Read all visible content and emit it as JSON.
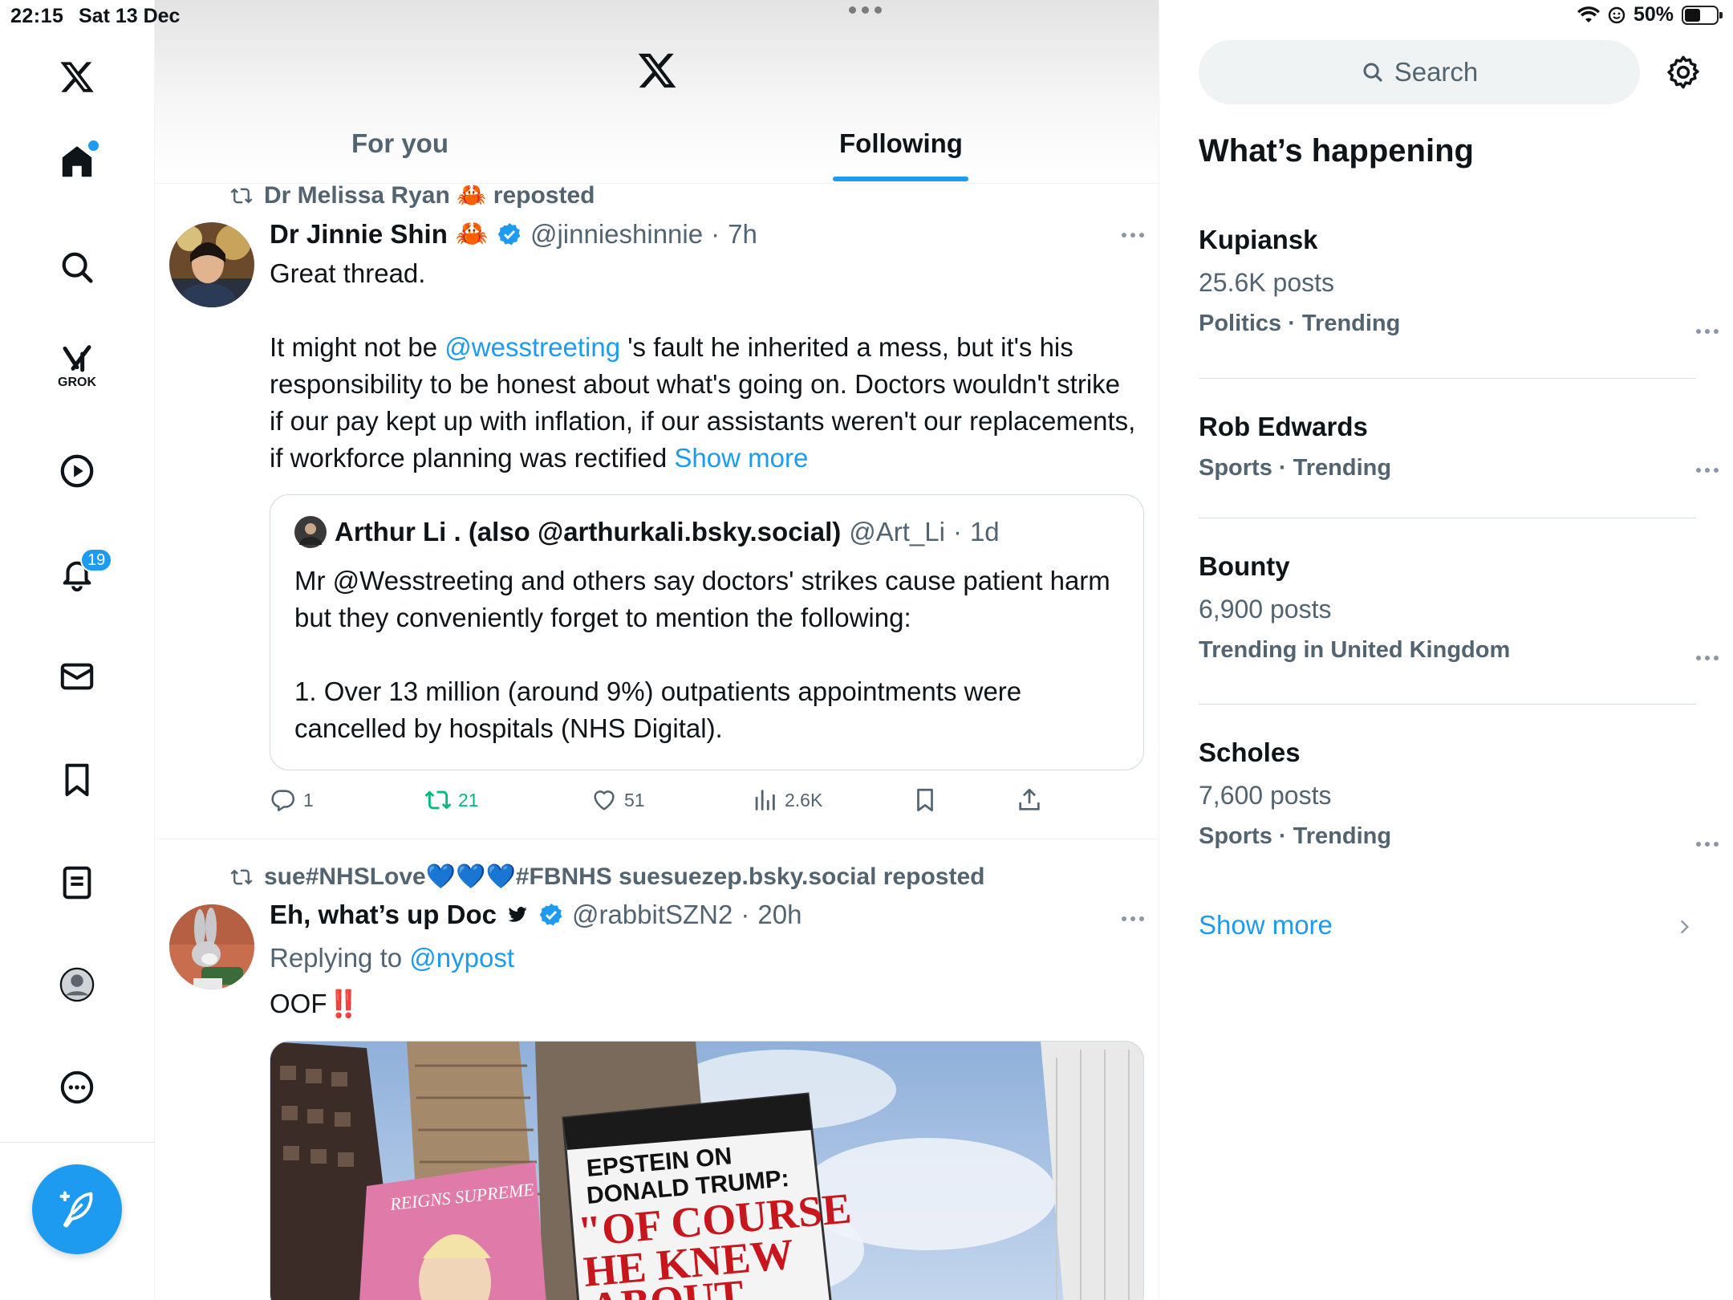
{
  "status": {
    "time": "22:15",
    "date": "Sat 13 Dec",
    "battery": "50%"
  },
  "nav": {
    "items": [
      "home-icon",
      "search-icon",
      "grok-icon",
      "video-icon",
      "notifications-icon",
      "messages-icon",
      "bookmarks-icon",
      "lists-icon",
      "profile-icon",
      "more-icon"
    ],
    "grok_label": "GROK",
    "notifications_badge": "19"
  },
  "header": {
    "tabs": [
      {
        "label": "For you",
        "active": false
      },
      {
        "label": "Following",
        "active": true
      }
    ]
  },
  "tweets": [
    {
      "repost_by": "Dr Melissa Ryan 🦀 reposted",
      "author_name": "Dr Jinnie Shin",
      "author_emoji": "🦀",
      "handle": "@jinnieshinnie",
      "sep": "·",
      "time": "7h",
      "text_line1": "Great thread.",
      "text_p2_a": "It might not be ",
      "mention": "@wesstreeting",
      "text_p2_b": " 's fault he inherited a mess, but it's his responsibility to be honest about what's going on. Doctors wouldn't strike if our pay kept up with inflation, if our assistants weren't our replacements, if workforce planning was rectified ",
      "show_more": "Show more",
      "quote": {
        "author_name": "Arthur Li . (also @arthurkali.bsky.social)",
        "handle": "@Art_Li",
        "sep": "·",
        "time": "1d",
        "p1": "Mr @Wesstreeting and others say doctors' strikes cause patient harm but they conveniently forget to mention the following:",
        "p2": "1. Over 13 million (around 9%) outpatients appointments were cancelled by hospitals (NHS Digital)."
      },
      "actions": {
        "replies": "1",
        "reposts": "21",
        "likes": "51",
        "views": "2.6K"
      }
    },
    {
      "repost_by": "sue#NHSLove💙💙💙#FBNHS suesuezep.bsky.social reposted",
      "author_name": "Eh, what’s up Doc",
      "handle": "@rabbitSZN2",
      "sep": "·",
      "time": "20h",
      "replying_prefix": "Replying to ",
      "replying_to": "@nypost",
      "text": "OOF",
      "text_emoji": "‼️",
      "media": {
        "billboard_line1": "EPSTEIN ON",
        "billboard_line2": "DONALD TRUMP:",
        "billboard_line3": "\"OF COURSE",
        "billboard_line4": "HE KNEW",
        "billboard_line5": "ABOUT",
        "left_sign": "REIGNS SUPREME"
      }
    }
  ],
  "sidebar": {
    "search_placeholder": "Search",
    "title": "What’s happening",
    "trends": [
      {
        "name": "Kupiansk",
        "count": "25.6K posts",
        "category": "Politics · Trending"
      },
      {
        "name": "Rob Edwards",
        "count": "",
        "category": "Sports · Trending"
      },
      {
        "name": "Bounty",
        "count": "6,900 posts",
        "category": "Trending in United Kingdom"
      },
      {
        "name": "Scholes",
        "count": "7,600 posts",
        "category": "Sports · Trending"
      }
    ],
    "show_more": "Show more"
  },
  "colors": {
    "accent": "#1d9bf0",
    "retweet": "#00ba7c",
    "secondary_text": "#536471"
  }
}
